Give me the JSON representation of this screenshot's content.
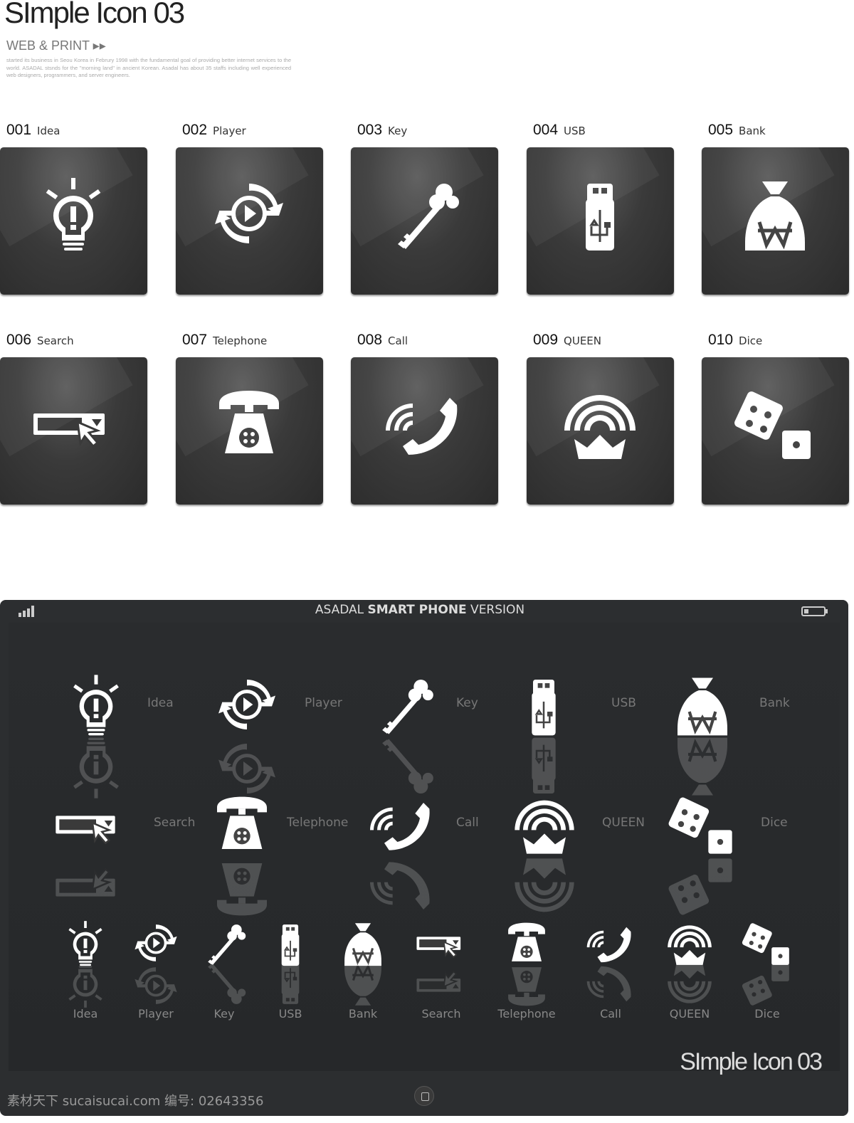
{
  "header": {
    "title": "SImple Icon 03",
    "subtitle": "WEB & PRINT ▸▸",
    "description": "started its business in Seou Korea in Februry 1998 with the fundamental goal of providing better internet services to the world. ASADAL stsnds for the \"morning land\" in ancient Korean. Asadal has about 35 staffs including well experienced web designers, programmers, and server engineers."
  },
  "icons": [
    {
      "num": "001",
      "label": "Idea",
      "icon": "lightbulb-icon"
    },
    {
      "num": "002",
      "label": "Player",
      "icon": "player-icon"
    },
    {
      "num": "003",
      "label": "Key",
      "icon": "key-icon"
    },
    {
      "num": "004",
      "label": "USB",
      "icon": "usb-icon"
    },
    {
      "num": "005",
      "label": "Bank",
      "icon": "money-bag-icon"
    },
    {
      "num": "006",
      "label": "Search",
      "icon": "search-box-icon"
    },
    {
      "num": "007",
      "label": "Telephone",
      "icon": "telephone-icon"
    },
    {
      "num": "008",
      "label": "Call",
      "icon": "call-icon"
    },
    {
      "num": "009",
      "label": "QUEEN",
      "icon": "crown-icon"
    },
    {
      "num": "010",
      "label": "Dice",
      "icon": "dice-icon"
    }
  ],
  "phone": {
    "title_pre": "ASADAL ",
    "title_bold": "SMART PHONE",
    "title_post": " VERSION",
    "brand": "SImple Icon 03",
    "signal_icon": "signal-icon",
    "battery_icon": "battery-icon",
    "home_icon": "home-button-icon"
  },
  "watermark": "素材天下 sucaisucai.com  编号: 02643356",
  "colors": {
    "tile": "#333333",
    "phone_bg": "#2c2e30",
    "accent": "#a8c8a0"
  }
}
